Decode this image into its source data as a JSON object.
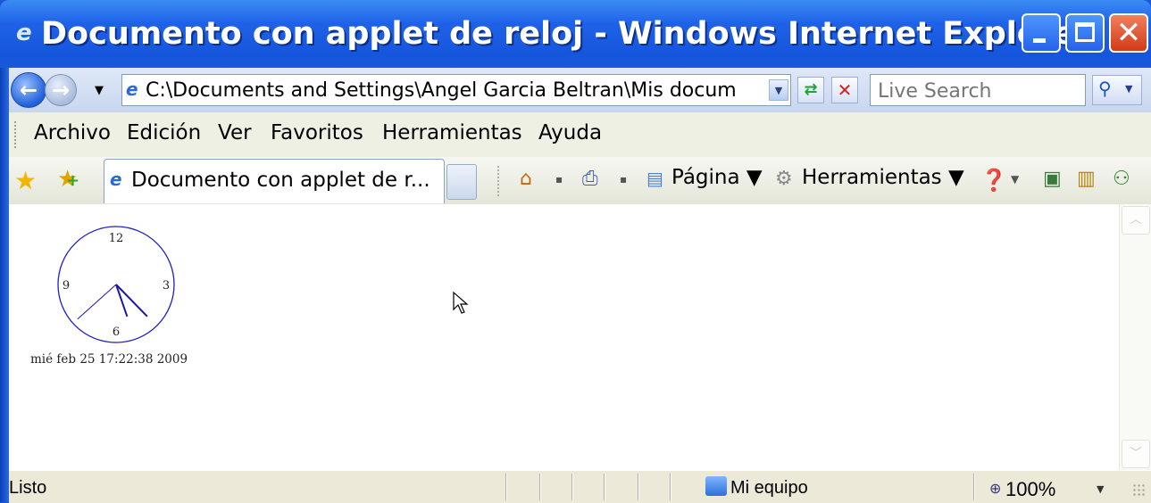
{
  "window": {
    "title": "Documento con applet de reloj - Windows Internet Explorer"
  },
  "address_bar": {
    "url": "C:\\Documents and Settings\\Angel Garcia Beltran\\Mis docum",
    "search_placeholder": "Live Search"
  },
  "menu": {
    "items": [
      "Archivo",
      "Edición",
      "Ver",
      "Favoritos",
      "Herramientas",
      "Ayuda"
    ]
  },
  "tabs": {
    "active_label": "Documento con applet de r..."
  },
  "command_bar": {
    "page_label": "Página",
    "tools_label": "Herramientas"
  },
  "clock": {
    "numerals": {
      "top": "12",
      "right": "3",
      "bottom": "6",
      "left": "9"
    },
    "date_text": "mié feb 25 17:22:38 2009",
    "time": {
      "hours": 17,
      "minutes": 22,
      "seconds": 38
    }
  },
  "status_bar": {
    "status": "Listo",
    "zone": "Mi equipo",
    "zoom": "100%"
  },
  "colors": {
    "titlebar": "#1f62e8",
    "clock_face": "#2020c0",
    "clock_hands": "#1a1aa0"
  }
}
